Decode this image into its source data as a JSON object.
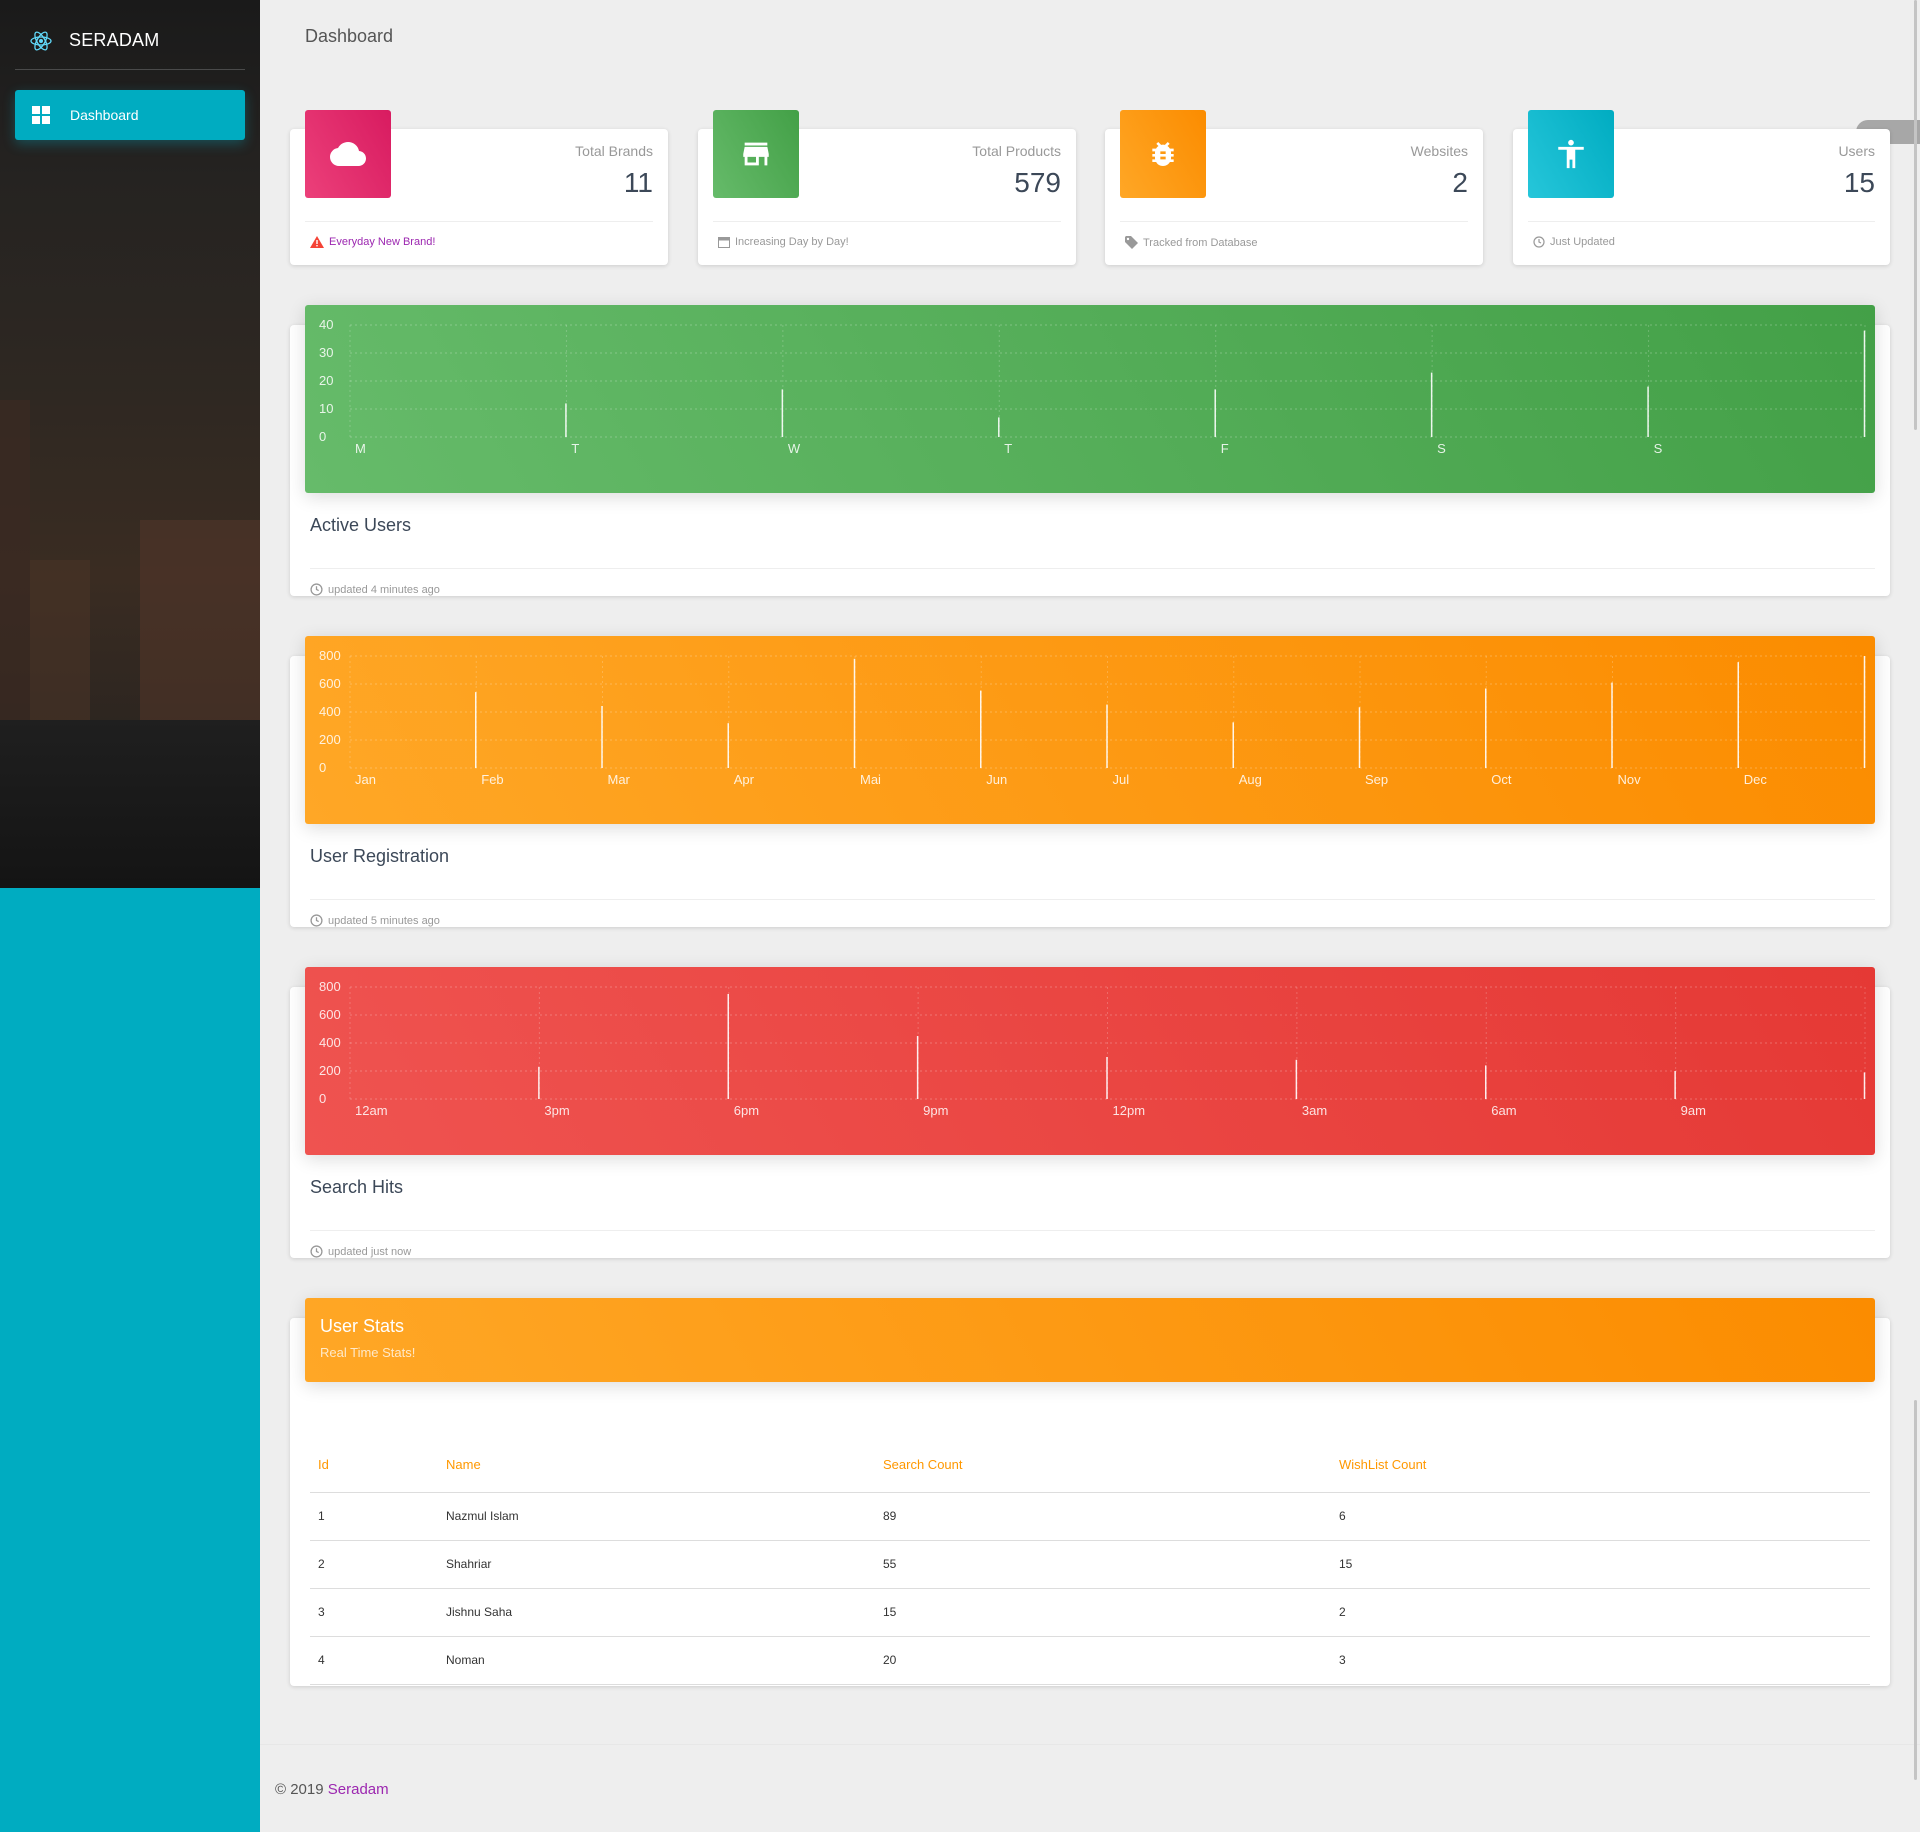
{
  "sidebar": {
    "brand": "SERADAM",
    "brand_icon": "atom-react-icon",
    "items": [
      {
        "label": "Dashboard",
        "icon": "dashboard-icon"
      }
    ]
  },
  "header": {
    "title": "Dashboard"
  },
  "stats": [
    {
      "label": "Total Brands",
      "value": "11",
      "footer": "Everyday New Brand!",
      "icon": "cloud-icon",
      "footer_icon": "warning-icon",
      "color": "#e91e63"
    },
    {
      "label": "Total Products",
      "value": "579",
      "footer": "Increasing Day by Day!",
      "icon": "store-icon",
      "footer_icon": "calendar-icon",
      "color": "#4caf50"
    },
    {
      "label": "Websites",
      "value": "2",
      "footer": "Tracked from Database",
      "icon": "bug-icon",
      "footer_icon": "tag-icon",
      "color": "#ff9800"
    },
    {
      "label": "Users",
      "value": "15",
      "footer": "Just Updated",
      "icon": "accessibility-icon",
      "footer_icon": "update-icon",
      "color": "#00bcd4"
    }
  ],
  "chart_data": [
    {
      "type": "bar",
      "title": "Active Users",
      "updated": "updated 4 minutes ago",
      "categories": [
        "M",
        "T",
        "W",
        "T",
        "F",
        "S",
        "S"
      ],
      "values": [
        12,
        17,
        7,
        17,
        23,
        18,
        38
      ],
      "ylim": [
        0,
        40
      ],
      "yticks": [
        "40",
        "30",
        "20",
        "10",
        "0"
      ],
      "color": "#4caf50",
      "grid": true
    },
    {
      "type": "bar",
      "title": "User Registration",
      "updated": "updated 5 minutes ago",
      "categories": [
        "Jan",
        "Feb",
        "Mar",
        "Apr",
        "Mai",
        "Jun",
        "Jul",
        "Aug",
        "Sep",
        "Oct",
        "Nov",
        "Dec"
      ],
      "values": [
        542,
        443,
        320,
        780,
        553,
        453,
        326,
        434,
        568,
        610,
        756,
        895
      ],
      "ylim": [
        0,
        800
      ],
      "yticks": [
        "800",
        "600",
        "400",
        "200",
        "0"
      ],
      "color": "#ff9800",
      "grid": true
    },
    {
      "type": "bar",
      "title": "Search Hits",
      "updated": "updated just now",
      "categories": [
        "12am",
        "3pm",
        "6pm",
        "9pm",
        "12pm",
        "3am",
        "6am",
        "9am"
      ],
      "values": [
        230,
        750,
        450,
        300,
        280,
        240,
        200,
        190
      ],
      "ylim": [
        0,
        800
      ],
      "yticks": [
        "800",
        "600",
        "400",
        "200",
        "0"
      ],
      "color": "#f44336",
      "grid": true
    }
  ],
  "table": {
    "title": "User Stats",
    "subtitle": "Real Time Stats!",
    "columns": [
      "Id",
      "Name",
      "Search Count",
      "WishList Count"
    ],
    "rows": [
      [
        "1",
        "Nazmul Islam",
        "89",
        "6"
      ],
      [
        "2",
        "Shahriar",
        "55",
        "15"
      ],
      [
        "3",
        "Jishnu Saha",
        "15",
        "2"
      ],
      [
        "4",
        "Noman",
        "20",
        "3"
      ]
    ]
  },
  "footer": {
    "copyright": "© 2019",
    "link": "Seradam"
  }
}
